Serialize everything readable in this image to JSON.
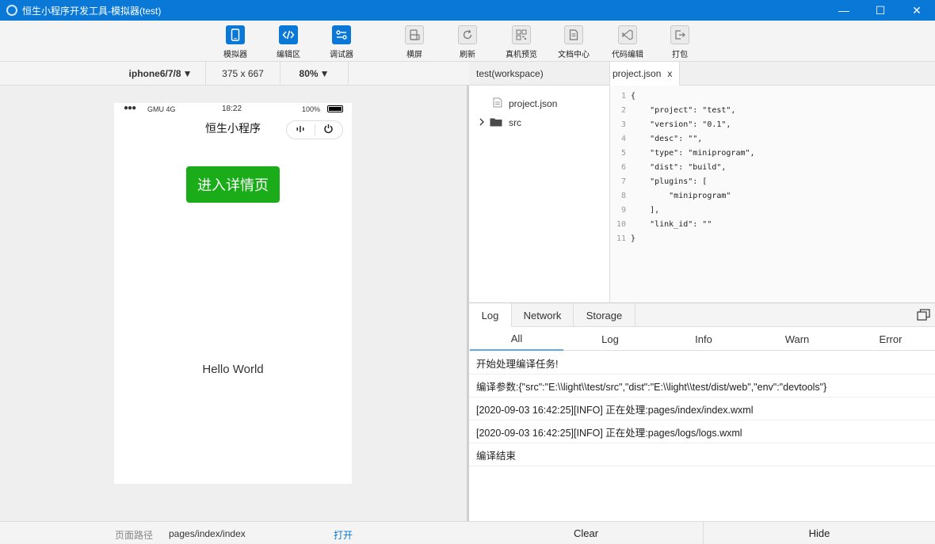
{
  "window": {
    "title": "恒生小程序开发工具-模拟器(test)",
    "minimize": "—",
    "maximize": "☐",
    "close": "✕"
  },
  "toolbar": {
    "simulator": "模拟器",
    "editor": "编辑区",
    "debugger": "调试器",
    "landscape": "横屏",
    "refresh": "刷新",
    "preview": "真机预览",
    "docs": "文档中心",
    "code_edit": "代码编辑",
    "pack": "打包"
  },
  "device": {
    "model": "iphone6/7/8",
    "resolution": "375 x 667",
    "zoom": "80%"
  },
  "phone": {
    "carrier": "GMU 4G",
    "time": "18:22",
    "battery": "100%",
    "nav_title": "恒生小程序",
    "button": "进入详情页",
    "hello": "Hello World"
  },
  "sim_footer": {
    "path_label": "页面路径",
    "path": "pages/index/index",
    "open": "打开"
  },
  "files": {
    "workspace": "test(workspace)",
    "open_tab": "project.json",
    "open_tab_close": "x",
    "tree": [
      {
        "name": "project.json"
      },
      {
        "name": "src"
      }
    ]
  },
  "editor": {
    "lines": [
      {
        "n": "1",
        "code": "{"
      },
      {
        "n": "2",
        "code": "    \"project\": \"test\","
      },
      {
        "n": "3",
        "code": "    \"version\": \"0.1\","
      },
      {
        "n": "4",
        "code": "    \"desc\": \"\","
      },
      {
        "n": "5",
        "code": "    \"type\": \"miniprogram\","
      },
      {
        "n": "6",
        "code": "    \"dist\": \"build\","
      },
      {
        "n": "7",
        "code": "    \"plugins\": ["
      },
      {
        "n": "8",
        "code": "        \"miniprogram\""
      },
      {
        "n": "9",
        "code": "    ],"
      },
      {
        "n": "10",
        "code": "    \"link_id\": \"\""
      },
      {
        "n": "11",
        "code": "}"
      }
    ]
  },
  "console": {
    "tabs": [
      "Log",
      "Network",
      "Storage"
    ],
    "levels": [
      "All",
      "Log",
      "Info",
      "Warn",
      "Error"
    ],
    "rows": [
      "开始处理编译任务!",
      "编译参数:{\"src\":\"E:\\\\light\\\\test/src\",\"dist\":\"E:\\\\light\\\\test/dist/web\",\"env\":\"devtools\"}",
      "[2020-09-03 16:42:25][INFO] 正在处理:pages/index/index.wxml",
      "[2020-09-03 16:42:25][INFO] 正在处理:pages/logs/logs.wxml",
      "编译结束"
    ],
    "clear": "Clear",
    "hide": "Hide"
  }
}
